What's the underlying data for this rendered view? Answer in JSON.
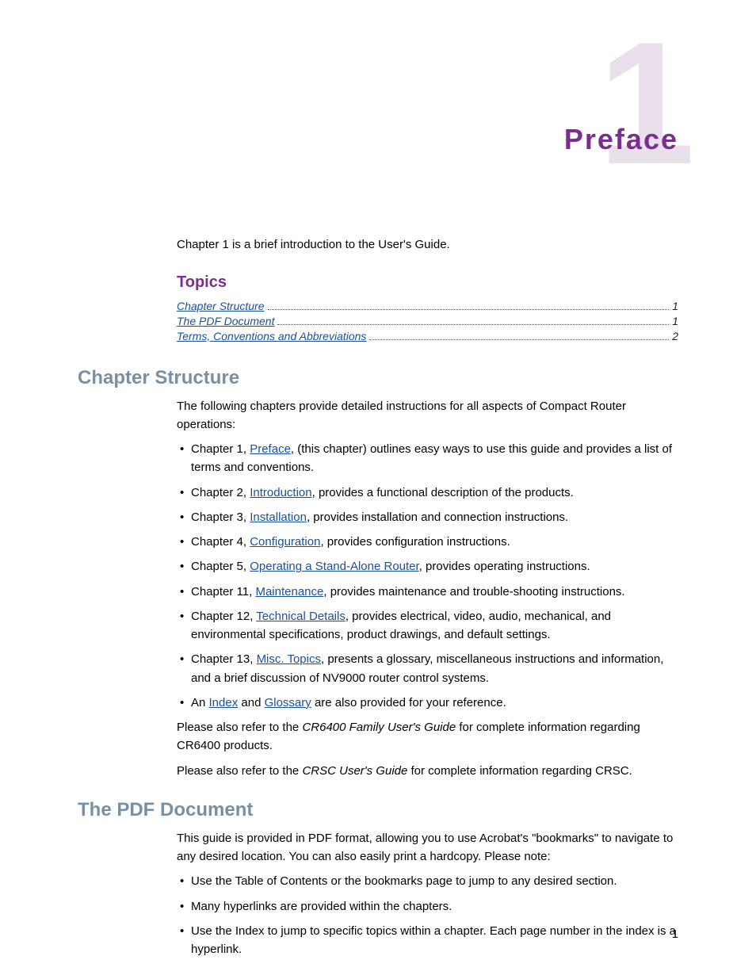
{
  "chapter_number": "1",
  "chapter_title": "Preface",
  "intro": "Chapter 1 is a brief introduction to the User's Guide.",
  "topics_heading": "Topics",
  "toc": [
    {
      "label": "Chapter Structure",
      "page": "1"
    },
    {
      "label": "The PDF Document",
      "page": "1"
    },
    {
      "label": "Terms, Conventions and Abbreviations",
      "page": "2"
    }
  ],
  "section1": {
    "heading": "Chapter Structure",
    "intro": "The following chapters provide detailed instructions for all aspects of Compact Router operations:",
    "bullets": [
      {
        "pre": "Chapter 1, ",
        "link": "Preface",
        "post": ", (this chapter) outlines easy ways to use this guide and provides a list of terms and conventions."
      },
      {
        "pre": "Chapter 2, ",
        "link": "Introduction",
        "post": ", provides a functional description of the products."
      },
      {
        "pre": "Chapter 3, ",
        "link": "Installation",
        "post": ", provides installation and connection instructions."
      },
      {
        "pre": "Chapter 4, ",
        "link": "Configuration",
        "post": ", provides configuration instructions."
      },
      {
        "pre": "Chapter 5, ",
        "link": "Operating a Stand-Alone Router",
        "post": ", provides operating instructions."
      },
      {
        "pre": "Chapter 11, ",
        "link": "Maintenance",
        "post": ", provides maintenance and trouble-shooting instructions."
      },
      {
        "pre": "Chapter 12, ",
        "link": "Technical Details",
        "post": ", provides electrical, video, audio, mechanical, and environmental specifications, product drawings, and default settings."
      },
      {
        "pre": "Chapter 13, ",
        "link": "Misc. Topics",
        "post": ", presents a glossary, miscellaneous instructions and information, and a brief discussion of NV9000 router control systems."
      }
    ],
    "last_bullet": {
      "pre": "An ",
      "link1": "Index",
      "mid": " and ",
      "link2": "Glossary",
      "post": " are also provided for your reference."
    },
    "para2_pre": "Please also refer to the ",
    "para2_em": "CR6400 Family User's Guide",
    "para2_post": " for complete information regarding CR6400 products.",
    "para3_pre": "Please also refer to the ",
    "para3_em": "CRSC User's Guide",
    "para3_post": " for complete information regarding CRSC."
  },
  "section2": {
    "heading": "The PDF Document",
    "intro": "This guide is provided in PDF format, allowing you to use Acrobat's \"bookmarks\" to navigate to any desired location. You can also easily print a hardcopy. Please note:",
    "bullets": [
      "Use the Table of Contents or the bookmarks page to jump to any desired section.",
      "Many hyperlinks are provided within the chapters.",
      "Use the Index to jump to specific topics within a chapter. Each page number in the index is a hyperlink."
    ]
  },
  "page_number": "1"
}
